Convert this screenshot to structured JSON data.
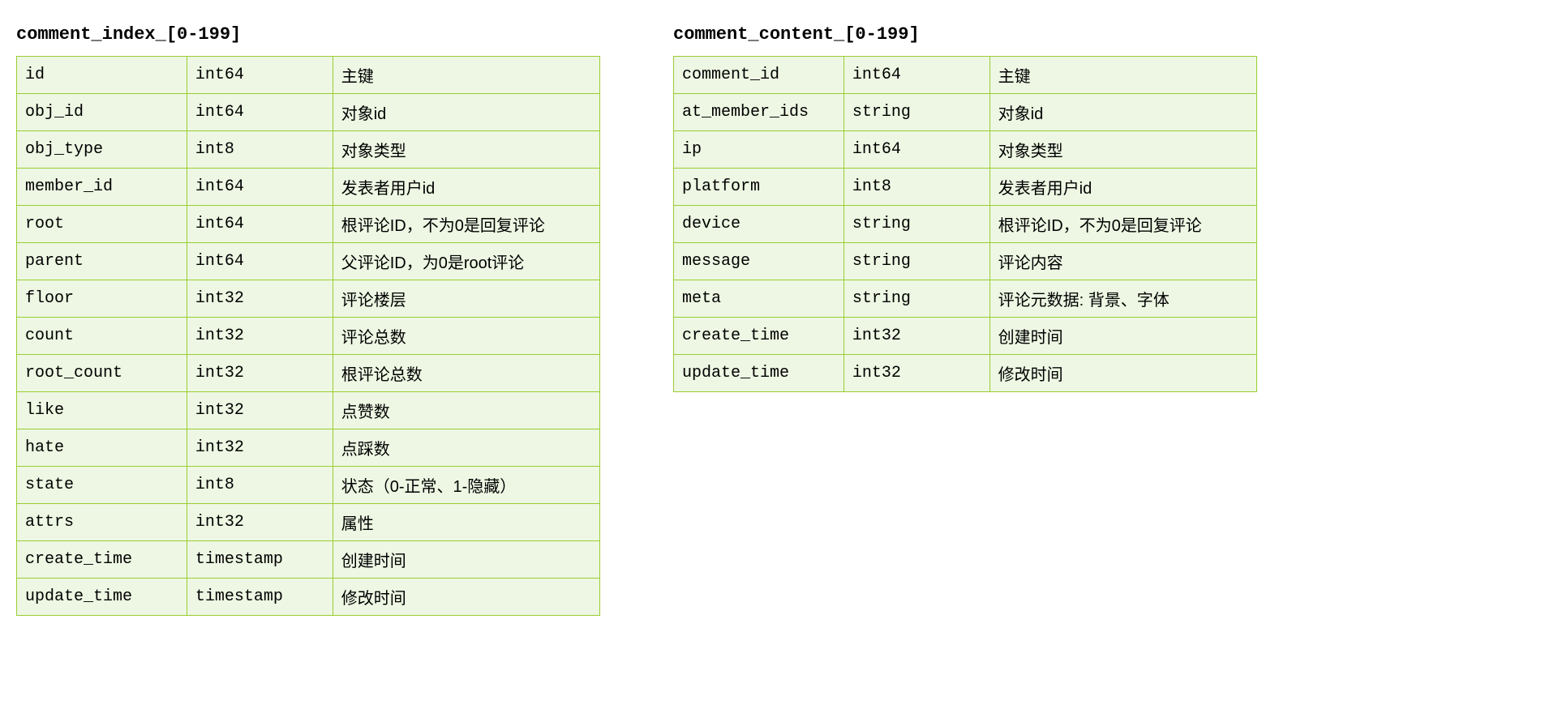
{
  "tables": [
    {
      "title": "comment_index_[0-199]",
      "rows": [
        {
          "field": "id",
          "type": "int64",
          "desc": "主键"
        },
        {
          "field": "obj_id",
          "type": "int64",
          "desc": "对象id"
        },
        {
          "field": "obj_type",
          "type": "int8",
          "desc": "对象类型"
        },
        {
          "field": "member_id",
          "type": "int64",
          "desc": "发表者用户id"
        },
        {
          "field": "root",
          "type": "int64",
          "desc": "根评论ID，不为0是回复评论"
        },
        {
          "field": "parent",
          "type": "int64",
          "desc": "父评论ID，为0是root评论"
        },
        {
          "field": "floor",
          "type": "int32",
          "desc": "评论楼层"
        },
        {
          "field": "count",
          "type": "int32",
          "desc": "评论总数"
        },
        {
          "field": "root_count",
          "type": "int32",
          "desc": "根评论总数"
        },
        {
          "field": "like",
          "type": "int32",
          "desc": "点赞数"
        },
        {
          "field": "hate",
          "type": "int32",
          "desc": "点踩数"
        },
        {
          "field": "state",
          "type": "int8",
          "desc": "状态（0-正常、1-隐藏）"
        },
        {
          "field": "attrs",
          "type": "int32",
          "desc": "属性"
        },
        {
          "field": "create_time",
          "type": "timestamp",
          "desc": "创建时间"
        },
        {
          "field": "update_time",
          "type": "timestamp",
          "desc": "修改时间"
        }
      ]
    },
    {
      "title": "comment_content_[0-199]",
      "rows": [
        {
          "field": "comment_id",
          "type": "int64",
          "desc": "主键"
        },
        {
          "field": "at_member_ids",
          "type": "string",
          "desc": "对象id"
        },
        {
          "field": "ip",
          "type": "int64",
          "desc": "对象类型"
        },
        {
          "field": "platform",
          "type": "int8",
          "desc": "发表者用户id"
        },
        {
          "field": "device",
          "type": "string",
          "desc": "根评论ID，不为0是回复评论"
        },
        {
          "field": "message",
          "type": "string",
          "desc": "评论内容"
        },
        {
          "field": "meta",
          "type": "string",
          "desc": "评论元数据: 背景、字体"
        },
        {
          "field": "create_time",
          "type": "int32",
          "desc": "创建时间"
        },
        {
          "field": "update_time",
          "type": "int32",
          "desc": "修改时间"
        }
      ]
    }
  ]
}
